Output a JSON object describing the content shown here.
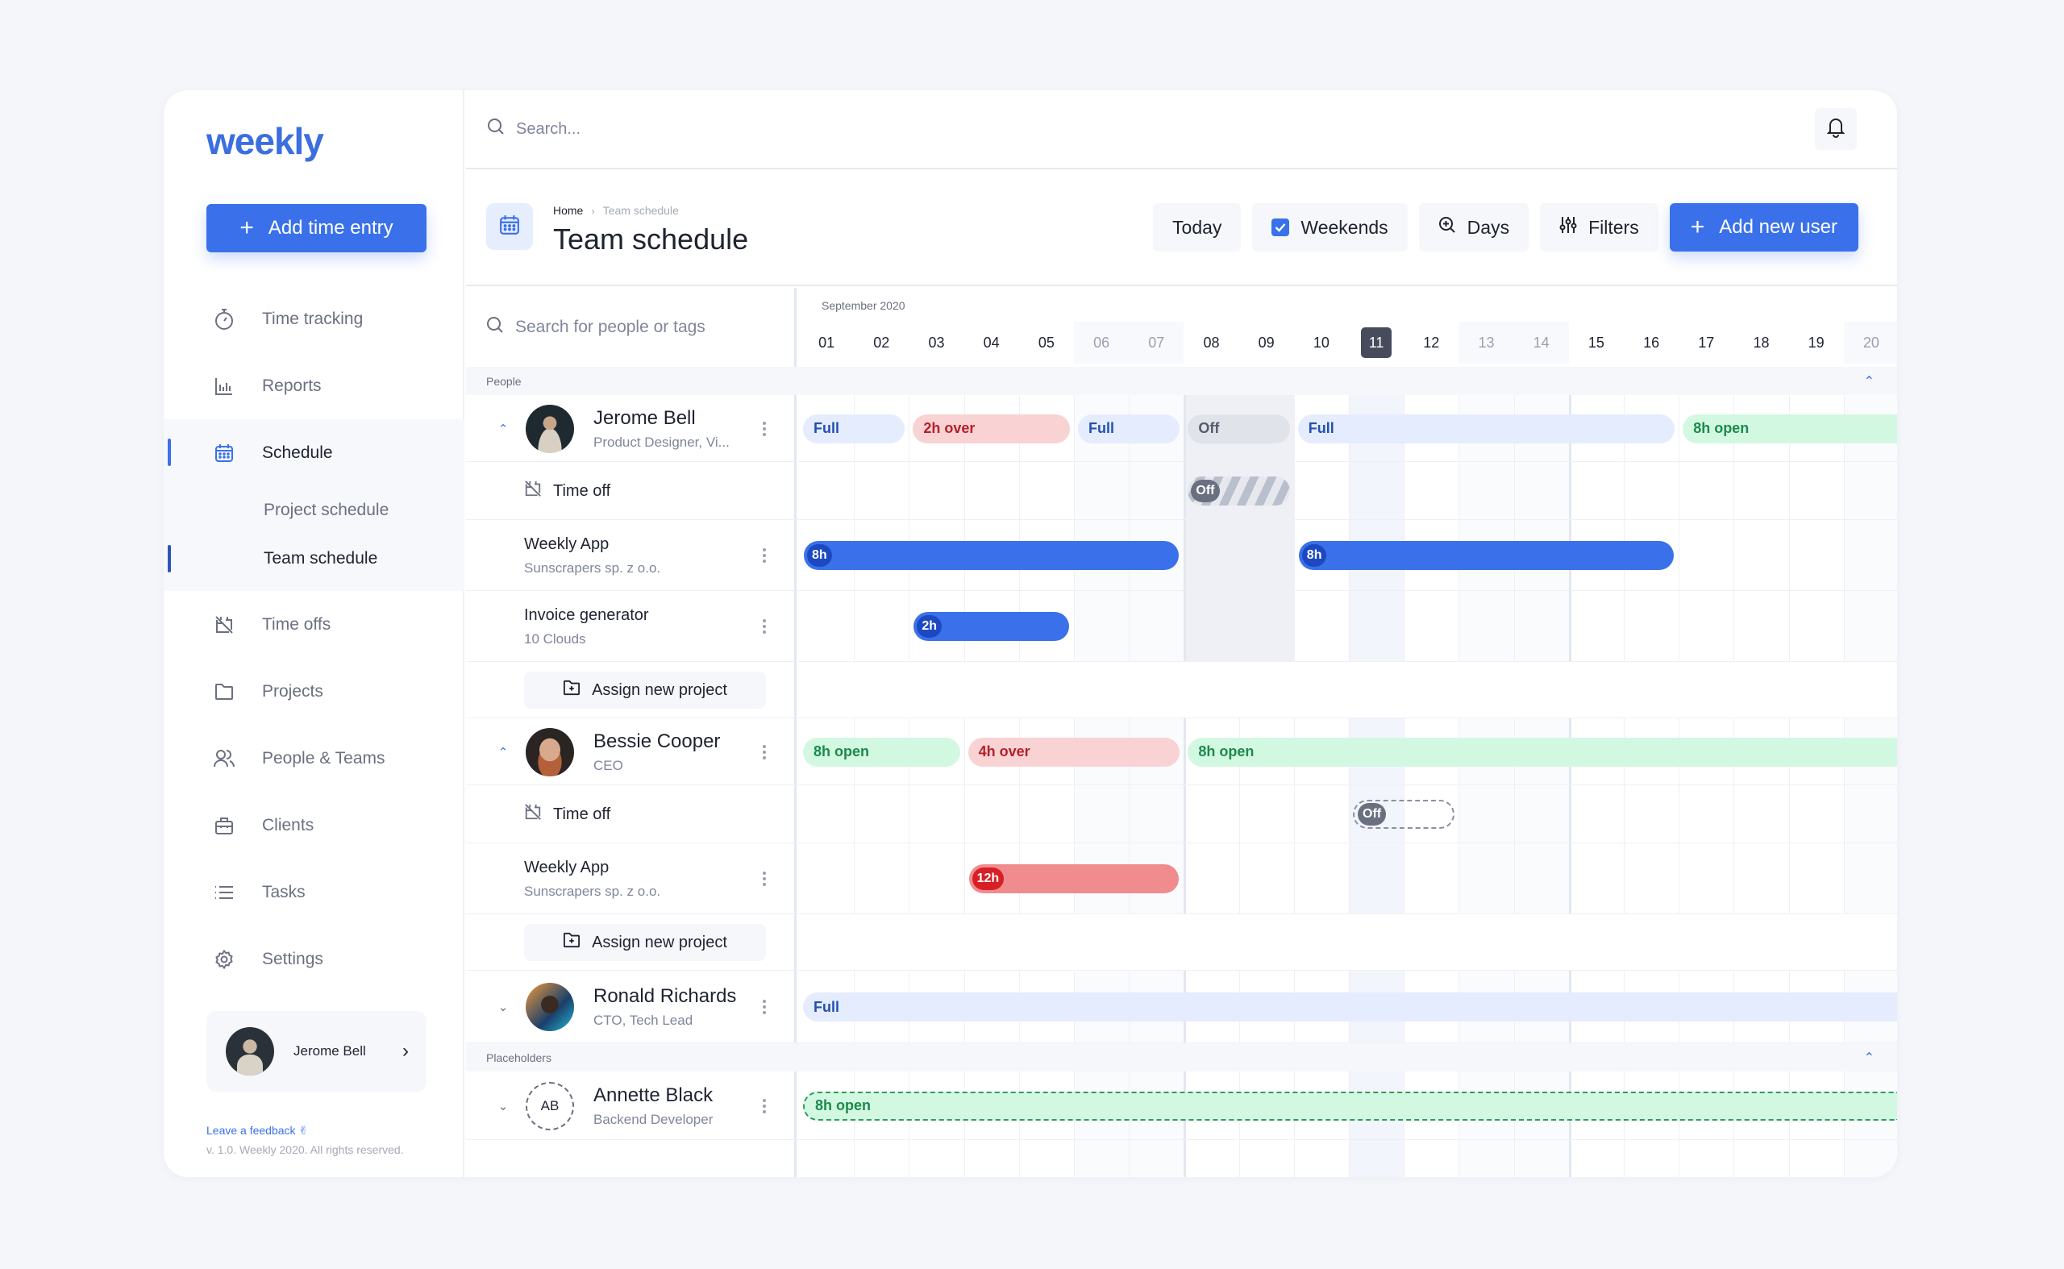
{
  "app": {
    "logo": "weekly"
  },
  "sidebar": {
    "add_time_entry": "Add time entry",
    "items": [
      {
        "label": "Time tracking",
        "icon": "stopwatch-icon"
      },
      {
        "label": "Reports",
        "icon": "bar-chart-icon"
      },
      {
        "label": "Schedule",
        "icon": "calendar-icon",
        "active": true,
        "children": [
          {
            "label": "Project schedule",
            "active": false
          },
          {
            "label": "Team schedule",
            "active": true
          }
        ]
      },
      {
        "label": "Time offs",
        "icon": "calendar-off-icon"
      },
      {
        "label": "Projects",
        "icon": "folder-icon"
      },
      {
        "label": "People & Teams",
        "icon": "users-icon"
      },
      {
        "label": "Clients",
        "icon": "briefcase-icon"
      },
      {
        "label": "Tasks",
        "icon": "list-icon"
      },
      {
        "label": "Settings",
        "icon": "gear-icon"
      }
    ],
    "user": {
      "name": "Jerome Bell"
    },
    "feedback": "Leave a feedback ✌",
    "copyright": "v. 1.0. Weekly 2020. All rights reserved."
  },
  "topbar": {
    "search_placeholder": "Search..."
  },
  "page": {
    "breadcrumb": {
      "home": "Home",
      "current": "Team schedule"
    },
    "title": "Team schedule",
    "toolbar": {
      "today": "Today",
      "weekends": "Weekends",
      "weekends_checked": true,
      "days": "Days",
      "filters": "Filters",
      "add_user": "Add new user"
    }
  },
  "schedule": {
    "people_search_placeholder": "Search for people or tags",
    "month": "September 2020",
    "days": [
      "01",
      "02",
      "03",
      "04",
      "05",
      "06",
      "07",
      "08",
      "09",
      "10",
      "11",
      "12",
      "13",
      "14",
      "15",
      "16",
      "17",
      "18",
      "19",
      "20"
    ],
    "weekend_days": [
      "06",
      "07",
      "13",
      "14",
      "20"
    ],
    "today": "11",
    "groups": {
      "people": "People",
      "placeholders": "Placeholders"
    },
    "assign_label": "Assign new project",
    "time_off_label": "Time off",
    "persons": [
      {
        "name": "Jerome Bell",
        "role": "Product Designer, Vi...",
        "expanded": true,
        "capacity": [
          {
            "label": "Full",
            "type": "full",
            "from": 1,
            "to": 2
          },
          {
            "label": "2h over",
            "type": "over",
            "from": 3,
            "to": 5
          },
          {
            "label": "Full",
            "type": "full",
            "from": 6,
            "to": 7
          },
          {
            "label": "Off",
            "type": "off",
            "from": 8,
            "to": 9
          },
          {
            "label": "Full",
            "type": "full",
            "from": 10,
            "to": 16
          },
          {
            "label": "8h open",
            "type": "open",
            "from": 17,
            "to": 20
          }
        ],
        "time_off": {
          "label": "Off",
          "from": 8,
          "to": 9,
          "status": "approved"
        },
        "projects": [
          {
            "name": "Weekly App",
            "client": "Sunscrapers sp. z o.o.",
            "bars": [
              {
                "hours": "8h",
                "from": 1,
                "to": 7,
                "color": "blue"
              },
              {
                "hours": "8h",
                "from": 10,
                "to": 16,
                "color": "blue"
              }
            ]
          },
          {
            "name": "Invoice generator",
            "client": "10 Clouds",
            "bars": [
              {
                "hours": "2h",
                "from": 3,
                "to": 5,
                "color": "blue"
              }
            ]
          }
        ]
      },
      {
        "name": "Bessie Cooper",
        "role": "CEO",
        "expanded": true,
        "capacity": [
          {
            "label": "8h open",
            "type": "open",
            "from": 1,
            "to": 3
          },
          {
            "label": "4h over",
            "type": "over",
            "from": 4,
            "to": 7
          },
          {
            "label": "8h open",
            "type": "open",
            "from": 8,
            "to": 20
          }
        ],
        "time_off": {
          "label": "Off",
          "from": 11,
          "to": 12,
          "status": "pending"
        },
        "projects": [
          {
            "name": "Weekly App",
            "client": "Sunscrapers sp. z o.o.",
            "bars": [
              {
                "hours": "12h",
                "from": 4,
                "to": 7,
                "color": "red"
              }
            ]
          }
        ]
      },
      {
        "name": "Ronald Richards",
        "role": "CTO, Tech Lead",
        "expanded": false,
        "capacity": [
          {
            "label": "Full",
            "type": "full",
            "from": 1,
            "to": 20
          }
        ]
      }
    ],
    "placeholders": [
      {
        "initials": "AB",
        "name": "Annette Black",
        "role": "Backend Developer",
        "expanded": false,
        "capacity": [
          {
            "label": "8h open",
            "type": "open",
            "from": 1,
            "to": 20,
            "dashed": true
          }
        ]
      }
    ]
  },
  "colors": {
    "accent": "#3a71ea",
    "full": "#e4ecfd",
    "over": "#f9d2d4",
    "open": "#d3f8e2",
    "off": "#e0e3ea",
    "bar_red": "#f08b8e"
  }
}
